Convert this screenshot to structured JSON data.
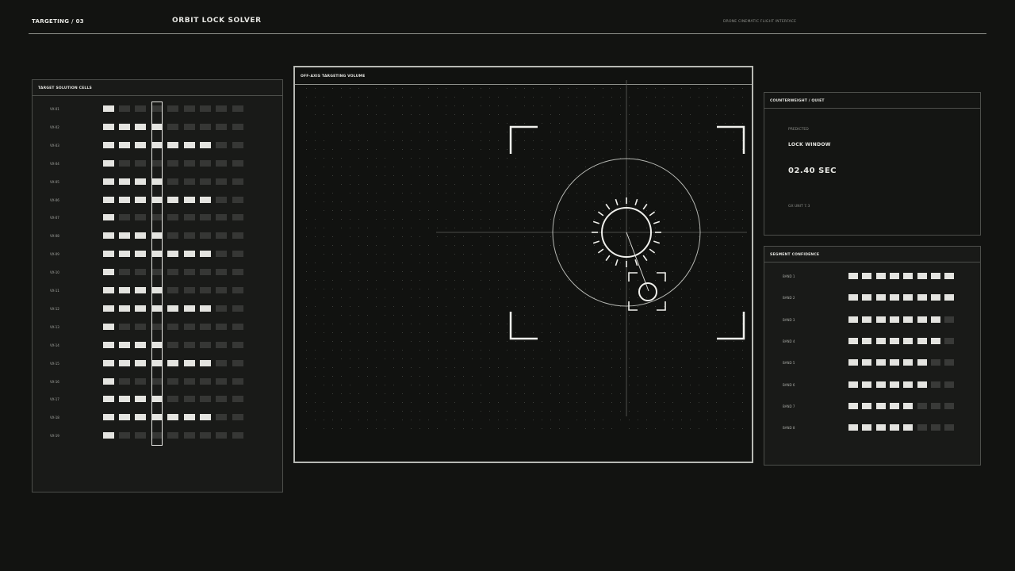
{
  "header": {
    "section": "TARGETING / 03",
    "title": "ORBIT LOCK SOLVER",
    "subtitle": "DRONE CINEMATIC FLIGHT INTERFACE"
  },
  "cells_panel": {
    "title": "TARGET SOLUTION CELLS",
    "highlighted_column": 3,
    "rows": [
      {
        "label": "VX-01",
        "on": [
          0
        ]
      },
      {
        "label": "VX-02",
        "on": [
          0,
          1,
          2,
          3
        ]
      },
      {
        "label": "VX-03",
        "on": [
          0,
          1,
          2,
          3,
          4,
          5,
          6
        ]
      },
      {
        "label": "VX-04",
        "on": [
          0
        ]
      },
      {
        "label": "VX-05",
        "on": [
          0,
          1,
          2,
          3
        ]
      },
      {
        "label": "VX-06",
        "on": [
          0,
          1,
          2,
          3,
          4,
          5,
          6
        ]
      },
      {
        "label": "VX-07",
        "on": [
          0
        ]
      },
      {
        "label": "VX-08",
        "on": [
          0,
          1,
          2,
          3
        ]
      },
      {
        "label": "VX-09",
        "on": [
          0,
          1,
          2,
          3,
          4,
          5,
          6
        ]
      },
      {
        "label": "VX-10",
        "on": [
          0
        ]
      },
      {
        "label": "VX-11",
        "on": [
          0,
          1,
          2,
          3
        ]
      },
      {
        "label": "VX-12",
        "on": [
          0,
          1,
          2,
          3,
          4,
          5,
          6
        ]
      },
      {
        "label": "VX-13",
        "on": [
          0
        ]
      },
      {
        "label": "VX-14",
        "on": [
          0,
          1,
          2,
          3
        ]
      },
      {
        "label": "VX-15",
        "on": [
          0,
          1,
          2,
          3,
          4,
          5,
          6
        ]
      },
      {
        "label": "VX-16",
        "on": [
          0
        ]
      },
      {
        "label": "VX-17",
        "on": [
          0,
          1,
          2,
          3
        ]
      },
      {
        "label": "VX-18",
        "on": [
          0,
          1,
          2,
          3,
          4,
          5,
          6
        ]
      },
      {
        "label": "VX-19",
        "on": [
          0
        ]
      }
    ]
  },
  "volume_panel": {
    "title": "OFF-AXIS TARGETING VOLUME"
  },
  "counter_panel": {
    "title": "COUNTERWEIGHT / QUIET",
    "predicted_label": "PREDICTED",
    "window_label": "LOCK WINDOW",
    "window_value": "02.40 SEC",
    "unit_label": "GX UNIT 7.3"
  },
  "confidence_panel": {
    "title": "SEGMENT CONFIDENCE",
    "bands": [
      {
        "label": "BAND 1",
        "filled": 8
      },
      {
        "label": "BAND 2",
        "filled": 8
      },
      {
        "label": "BAND 3",
        "filled": 7
      },
      {
        "label": "BAND 4",
        "filled": 7
      },
      {
        "label": "BAND 5",
        "filled": 6
      },
      {
        "label": "BAND 6",
        "filled": 6
      },
      {
        "label": "BAND 7",
        "filled": 5
      },
      {
        "label": "BAND 8",
        "filled": 5
      }
    ],
    "segments_total": 8
  },
  "colors": {
    "background": "#121311",
    "panel": "#191a18",
    "cell_on": "#e4e4e0",
    "cell_off": "#363735",
    "accent_line": "#b7b9b4"
  }
}
